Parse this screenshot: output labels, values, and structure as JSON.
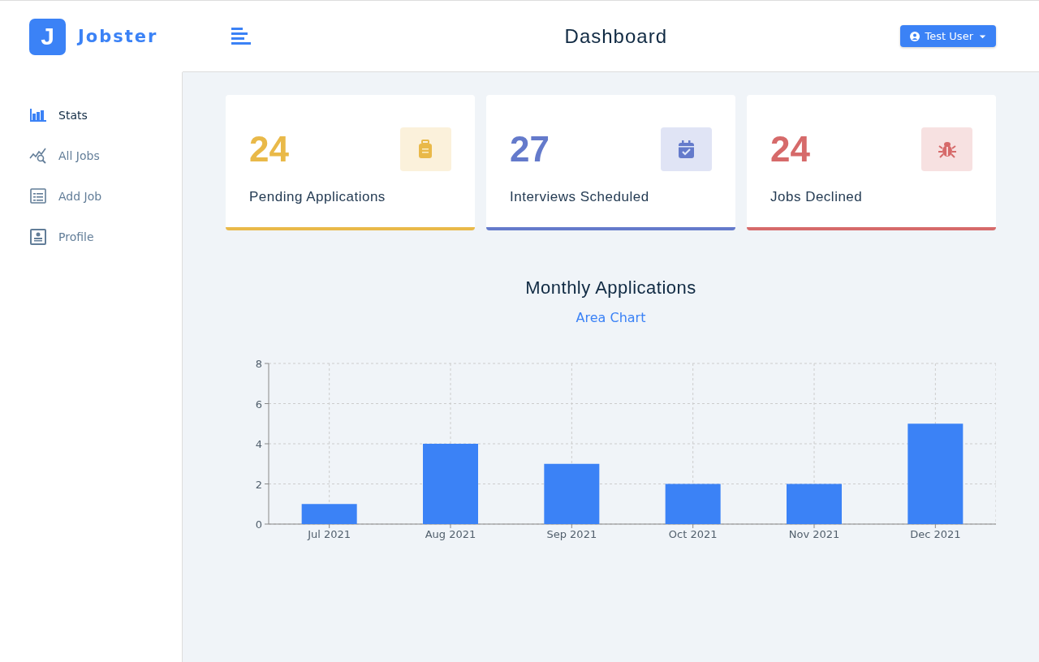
{
  "brand": {
    "logo": "J",
    "name": "Jobster"
  },
  "header": {
    "title": "Dashboard",
    "user": "Test User"
  },
  "sidebar": {
    "items": [
      {
        "kind": "stats",
        "label": "Stats",
        "selected": true
      },
      {
        "kind": "jobs",
        "label": "All Jobs",
        "selected": false
      },
      {
        "kind": "add",
        "label": "Add Job",
        "selected": false
      },
      {
        "kind": "profile",
        "label": "Profile",
        "selected": false
      }
    ]
  },
  "stats": [
    {
      "kind": "briefcase",
      "count": "24",
      "label": "Pending Applications",
      "color": "#e9b949"
    },
    {
      "kind": "calendar",
      "count": "27",
      "label": "Interviews Scheduled",
      "color": "#647acb"
    },
    {
      "kind": "bug",
      "count": "24",
      "label": "Jobs Declined",
      "color": "#d66a6a"
    }
  ],
  "chart": {
    "title": "Monthly Applications",
    "toggle": "Area Chart",
    "chart_data": {
      "type": "bar",
      "categories": [
        "Jul 2021",
        "Aug 2021",
        "Sep 2021",
        "Oct 2021",
        "Nov 2021",
        "Dec 2021"
      ],
      "values": [
        1,
        4,
        3,
        2,
        2,
        5
      ],
      "grid": true,
      "ylim": [
        0,
        8
      ],
      "yticks": [
        0,
        2,
        4,
        6,
        8
      ]
    }
  }
}
